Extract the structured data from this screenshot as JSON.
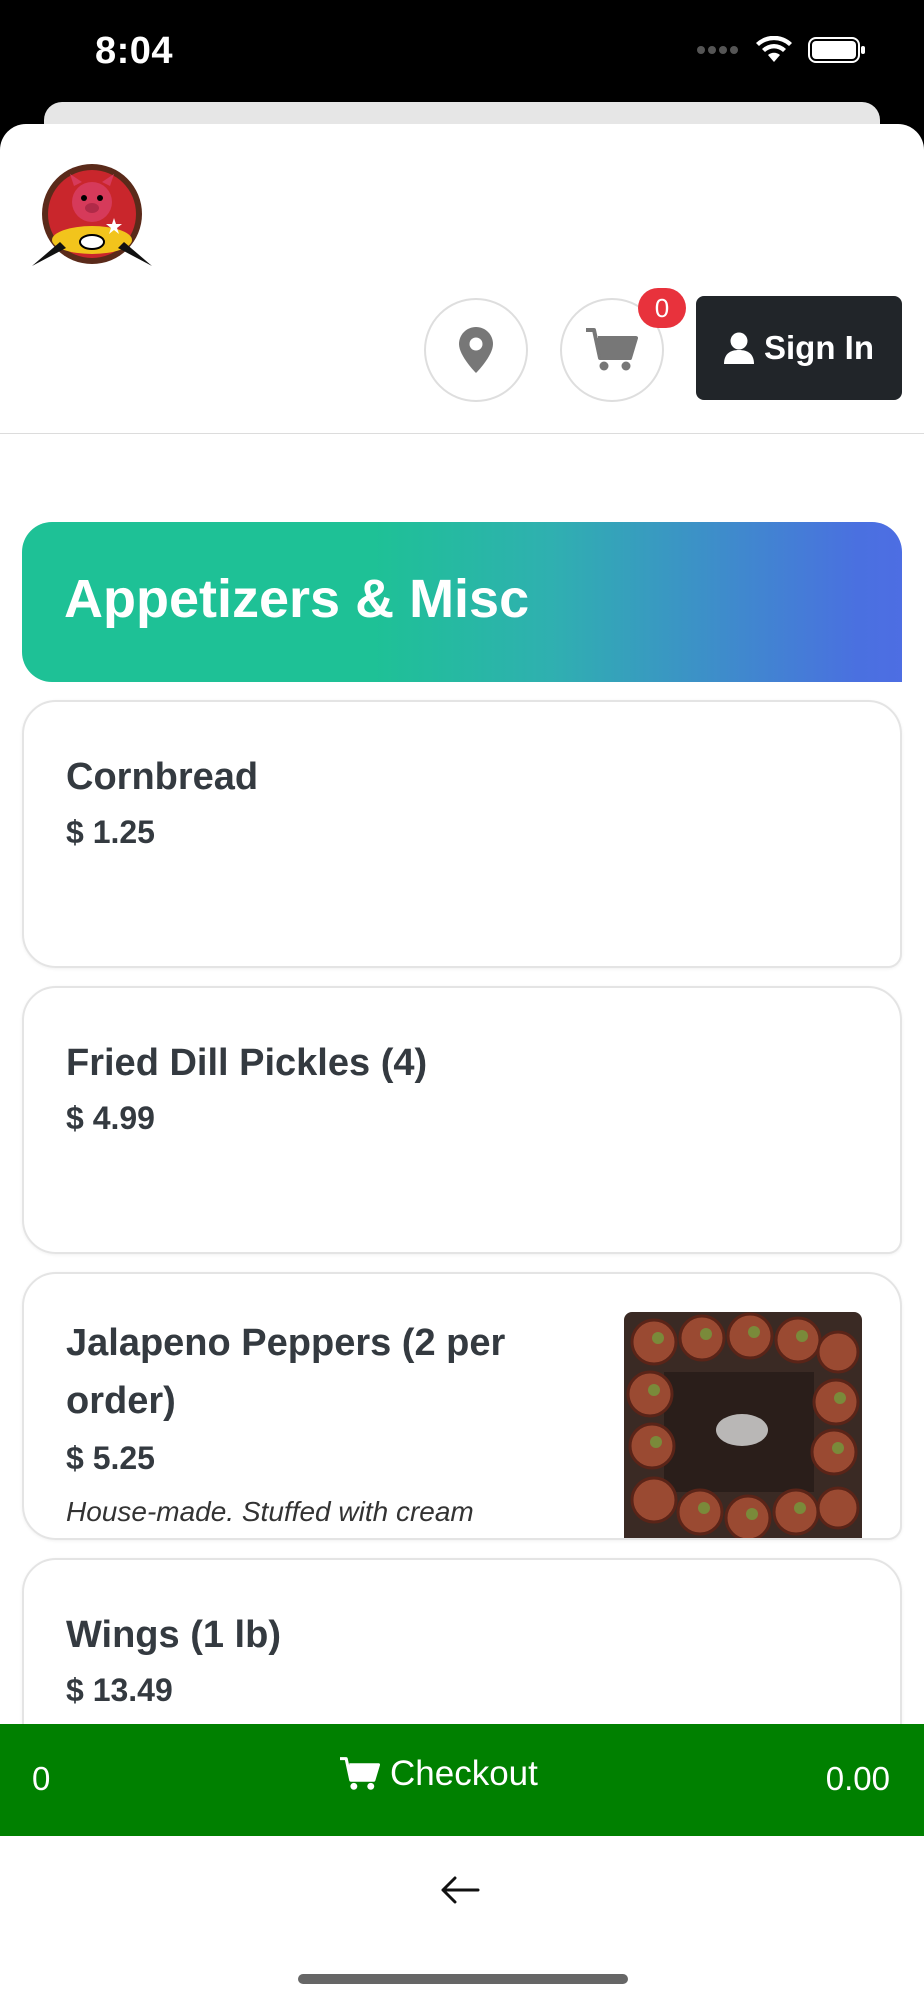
{
  "status_bar": {
    "time": "8:04"
  },
  "header": {
    "cart_count": "0",
    "signin_label": "Sign In"
  },
  "category": {
    "title": "Appetizers & Misc"
  },
  "items": [
    {
      "name": "Cornbread",
      "price": "$ 1.25"
    },
    {
      "name": "Fried Dill Pickles (4)",
      "price": "$ 4.99"
    },
    {
      "name_line1": "Jalapeno Peppers (2 per",
      "name_line2": "order)",
      "price": "$ 5.25",
      "description": "House-made. Stuffed with cream"
    },
    {
      "name": "Wings (1 lb)",
      "price": "$ 13.49"
    }
  ],
  "checkout": {
    "count": "0",
    "label": "Checkout",
    "total": "0.00"
  },
  "colors": {
    "checkout_green": "#008000",
    "badge_red": "#e8323c",
    "signin_dark": "#212529"
  },
  "icons": [
    "location-pin-icon",
    "cart-icon",
    "user-icon",
    "back-arrow-icon",
    "wifi-icon",
    "battery-icon",
    "signal-icon"
  ]
}
